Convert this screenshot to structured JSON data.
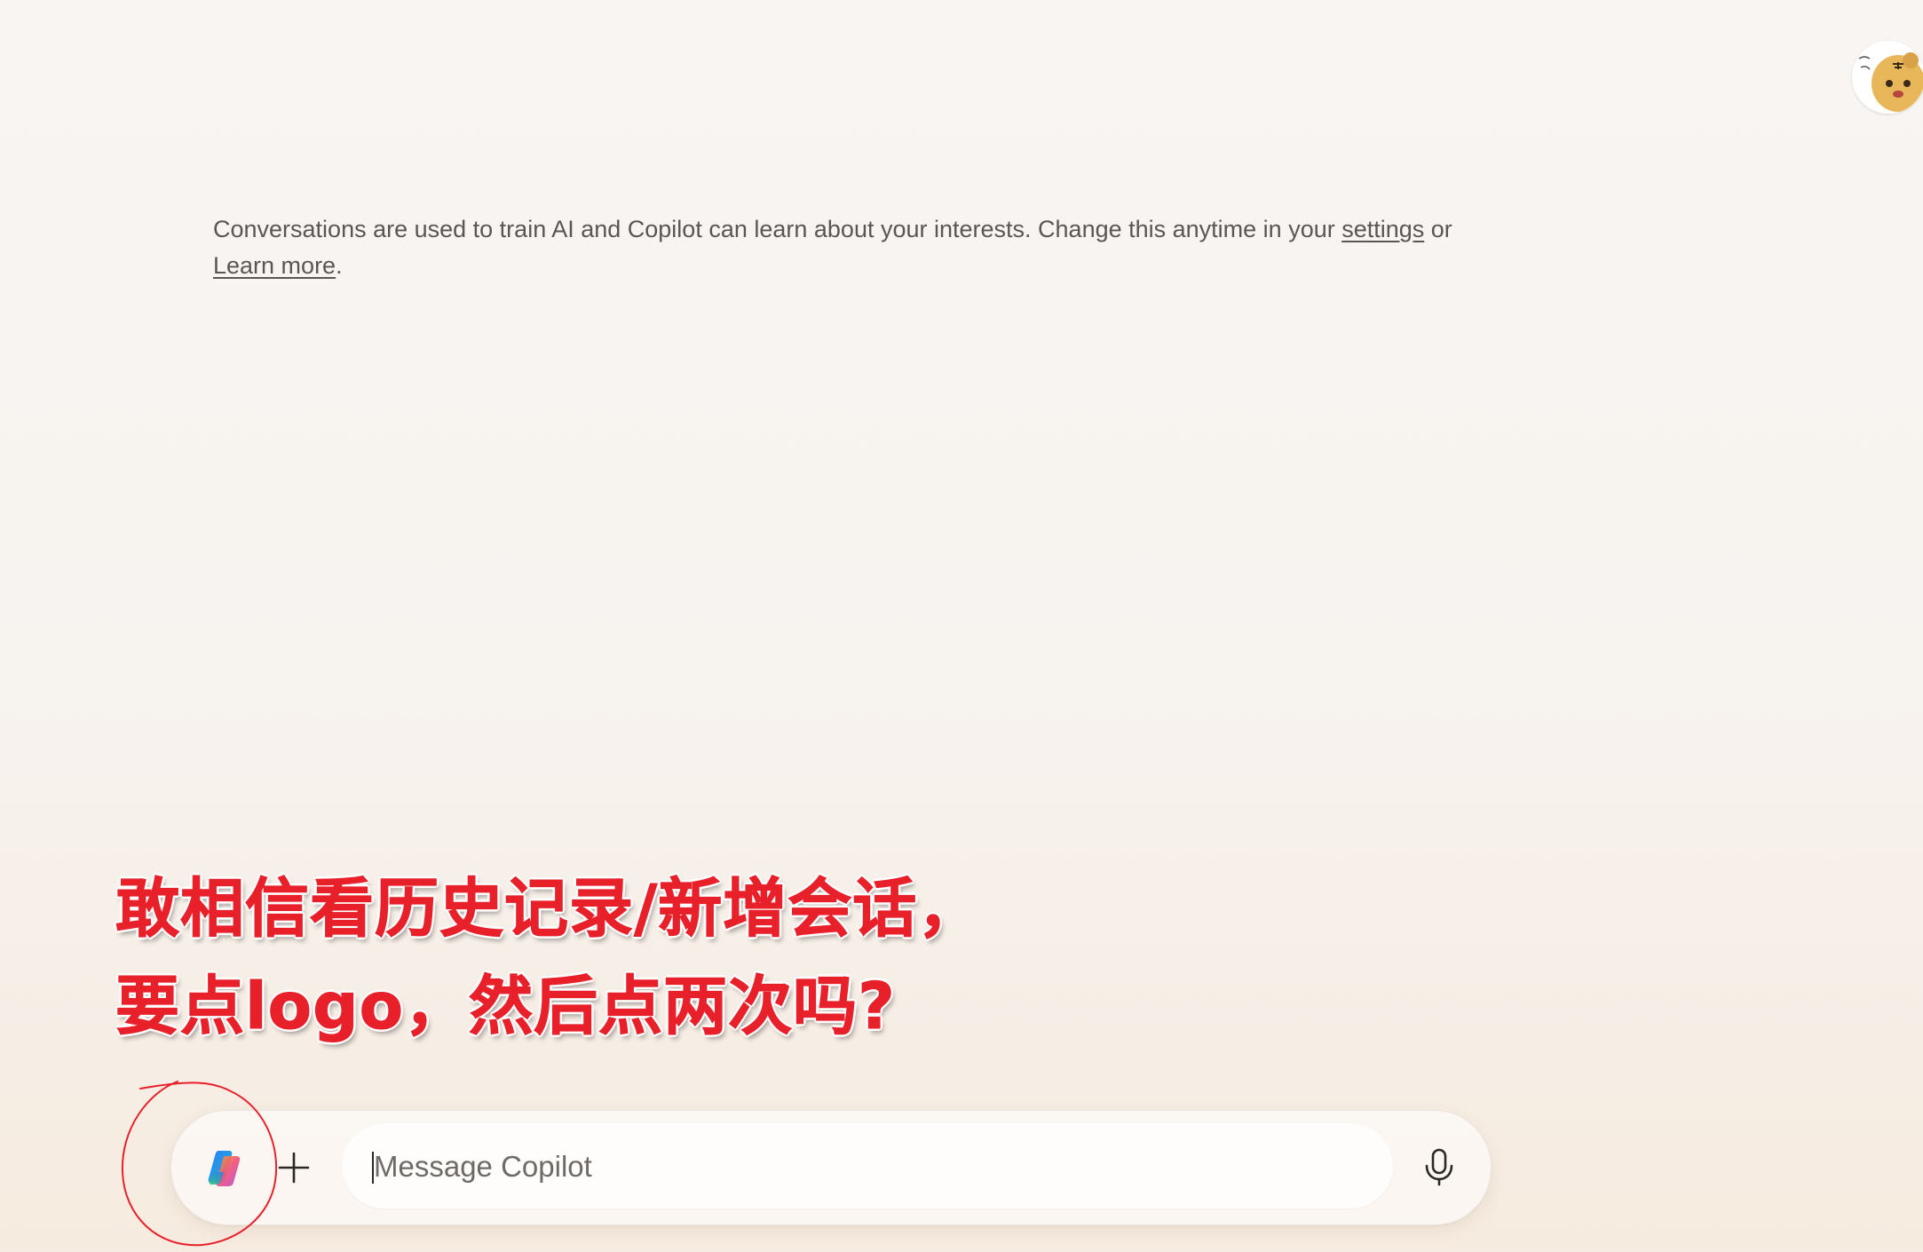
{
  "notice": {
    "text_before": "Conversations are used to train AI and Copilot can learn about your interests. Change this anytime in your ",
    "settings_link": "settings",
    "middle": " or ",
    "learn_more_link": "Learn more",
    "end": "."
  },
  "annotation": {
    "line1": "敢相信看历史记录/新增会话，",
    "line2": "要点logo，然后点两次吗?"
  },
  "composer": {
    "placeholder": "Message Copilot",
    "logo_icon": "copilot-logo-icon",
    "plus_icon": "plus-icon",
    "mic_icon": "microphone-icon"
  },
  "colors": {
    "annotation": "#e8202a",
    "background": "#f8f5f3",
    "text": "#5a5652"
  }
}
